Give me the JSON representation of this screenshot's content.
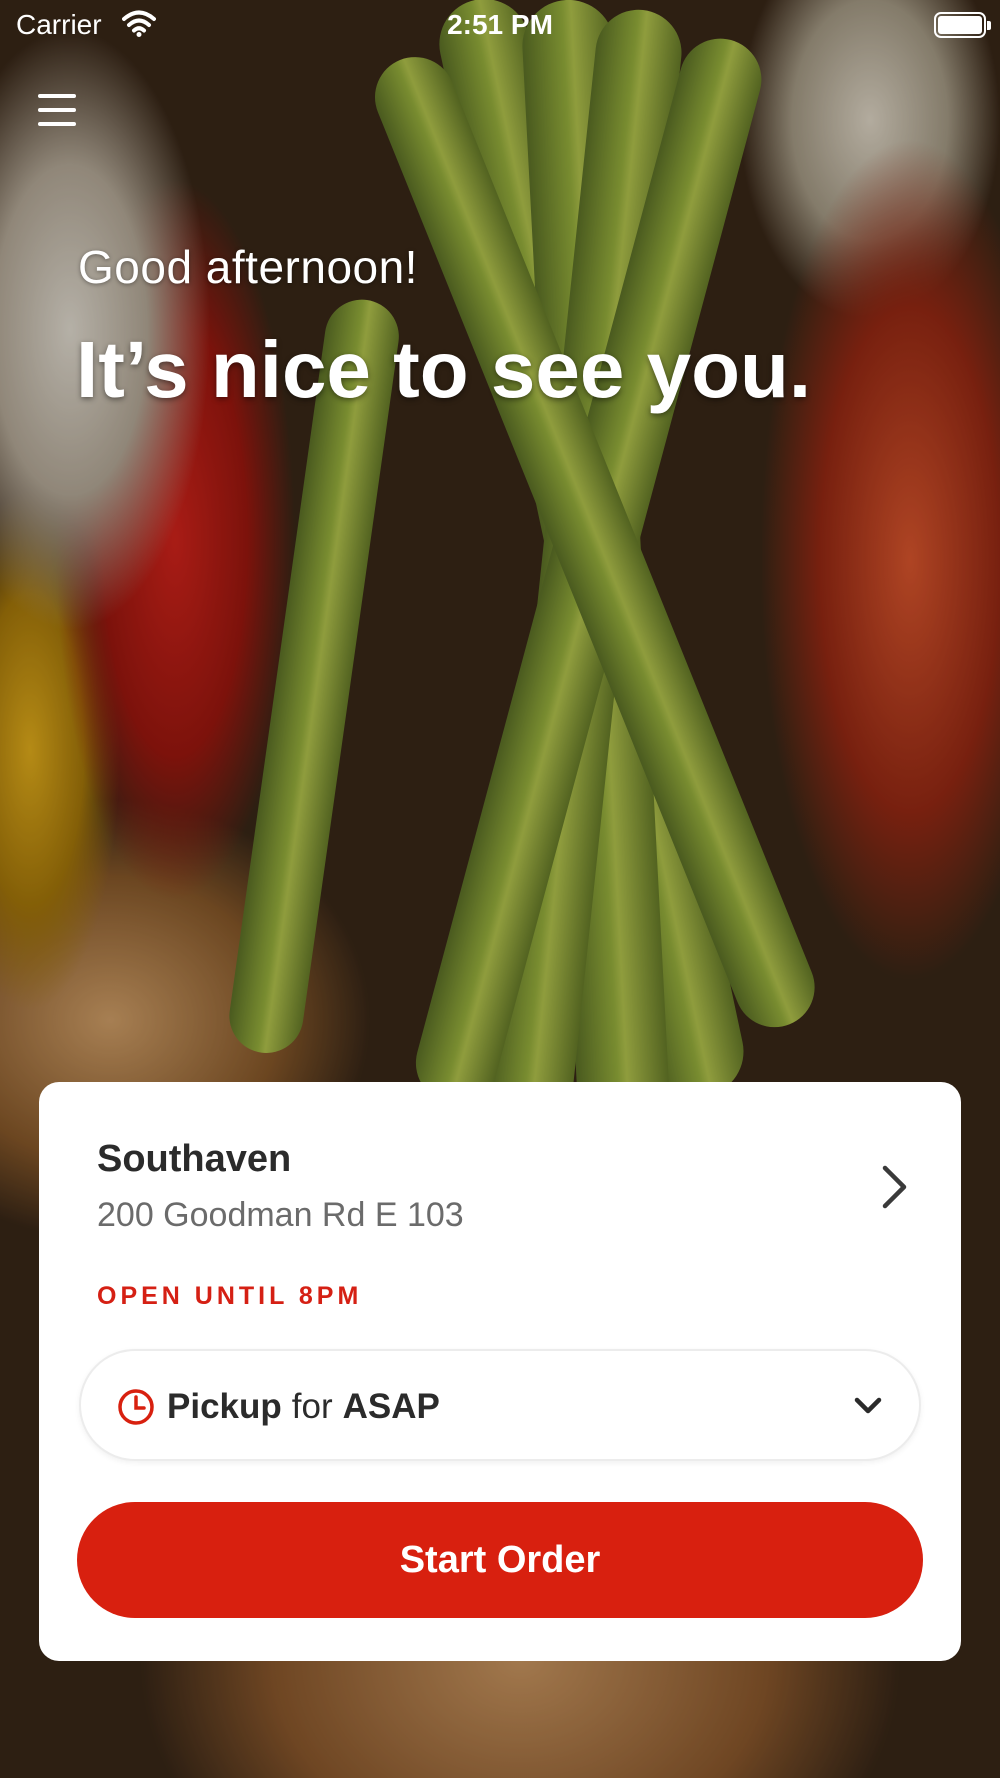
{
  "status_bar": {
    "carrier": "Carrier",
    "time": "2:51 PM",
    "battery_level": 1.0
  },
  "header": {
    "menu_icon": "hamburger-menu-icon"
  },
  "hero": {
    "greeting": "Good afternoon!",
    "headline": "It’s nice to see you."
  },
  "location": {
    "name": "Southaven",
    "address": "200 Goodman Rd E 103",
    "hours": "OPEN UNTIL 8PM",
    "icon": "chevron-right-icon"
  },
  "order_time": {
    "mode": "Pickup",
    "connector": "for",
    "when": "ASAP",
    "icon": "clock-icon",
    "dropdown_icon": "chevron-down-icon"
  },
  "actions": {
    "start_order_label": "Start Order"
  },
  "colors": {
    "accent": "#d8200f",
    "card_background": "#ffffff",
    "text_primary": "#2b2b2b",
    "text_secondary": "#6b6b6b"
  }
}
